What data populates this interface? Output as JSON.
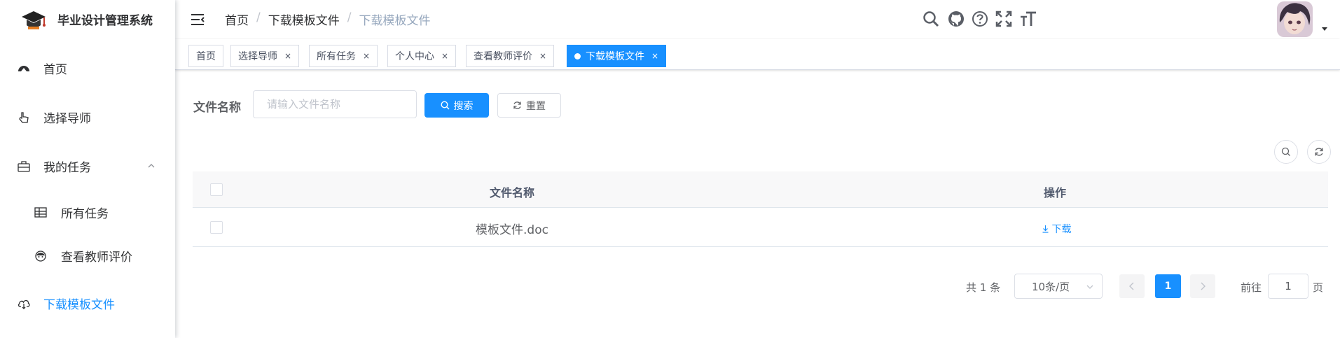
{
  "app": {
    "title": "毕业设计管理系统"
  },
  "sidebar": {
    "items": [
      {
        "label": "首页",
        "icon": "dashboard-icon"
      },
      {
        "label": "选择导师",
        "icon": "pointer-hand-icon"
      },
      {
        "label": "我的任务",
        "icon": "briefcase-icon",
        "expanded": true
      },
      {
        "label": "所有任务",
        "icon": "table-icon"
      },
      {
        "label": "查看教师评价",
        "icon": "user-face-icon"
      },
      {
        "label": "下载模板文件",
        "icon": "cloud-download-icon",
        "active": true
      }
    ]
  },
  "header": {
    "breadcrumb": [
      "首页",
      "下载模板文件",
      "下载模板文件"
    ],
    "icons": [
      "search-icon",
      "github-icon",
      "help-icon",
      "fullscreen-icon",
      "font-size-icon"
    ]
  },
  "tags": [
    {
      "label": "首页",
      "closable": false
    },
    {
      "label": "选择导师",
      "closable": true
    },
    {
      "label": "所有任务",
      "closable": true
    },
    {
      "label": "个人中心",
      "closable": true
    },
    {
      "label": "查看教师评价",
      "closable": true
    },
    {
      "label": "下载模板文件",
      "closable": true,
      "active": true
    }
  ],
  "tag_close": "×",
  "search": {
    "label": "文件名称",
    "placeholder": "请输入文件名称",
    "value": "",
    "search_button": "搜索",
    "reset_button": "重置"
  },
  "table": {
    "columns": [
      "文件名称",
      "操作"
    ],
    "rows": [
      {
        "file_name": "模板文件.doc",
        "action": "下载"
      }
    ]
  },
  "pagination": {
    "total_text": "共 1 条",
    "page_size": "10条/页",
    "current_page": "1",
    "goto_label": "前往",
    "goto_value": "1",
    "page_suffix": "页"
  },
  "colors": {
    "primary": "#1890ff",
    "text": "#303133",
    "muted": "#97a8be"
  }
}
